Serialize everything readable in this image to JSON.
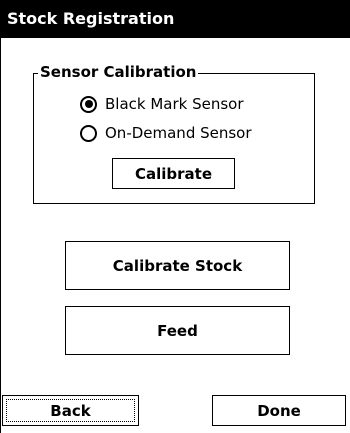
{
  "window": {
    "title": "Stock Registration"
  },
  "sensor_calibration": {
    "group_label": "Sensor Calibration",
    "options": [
      {
        "label": "Black Mark Sensor",
        "selected": true
      },
      {
        "label": "On-Demand Sensor",
        "selected": false
      }
    ],
    "calibrate_label": "Calibrate"
  },
  "actions": {
    "calibrate_stock_label": "Calibrate Stock",
    "feed_label": "Feed"
  },
  "footer": {
    "back_label": "Back",
    "done_label": "Done",
    "focused_button": "Back"
  }
}
